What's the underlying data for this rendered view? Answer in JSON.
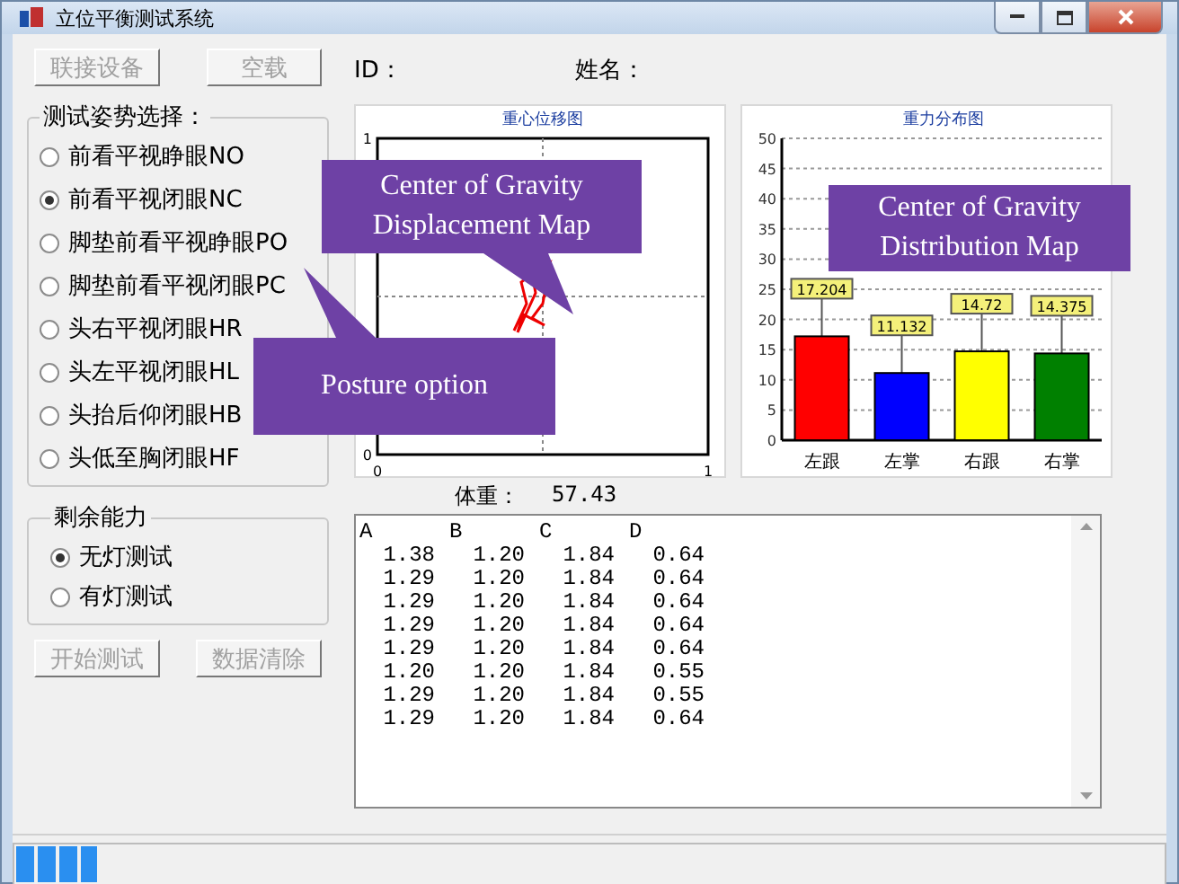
{
  "window": {
    "title": "立位平衡测试系统"
  },
  "top_buttons": [
    {
      "label": "联接设备",
      "disabled": true
    },
    {
      "label": "空载",
      "disabled": true
    }
  ],
  "posture_group": {
    "title": "测试姿势选择：",
    "options": [
      {
        "label": "前看平视睁眼NO",
        "selected": false
      },
      {
        "label": "前看平视闭眼NC",
        "selected": true
      },
      {
        "label": "脚垫前看平视睁眼PO",
        "selected": false
      },
      {
        "label": "脚垫前看平视闭眼PC",
        "selected": false
      },
      {
        "label": "头右平视闭眼HR",
        "selected": false
      },
      {
        "label": "头左平视闭眼HL",
        "selected": false
      },
      {
        "label": "头抬后仰闭眼HB",
        "selected": false
      },
      {
        "label": "头低至胸闭眼HF",
        "selected": false
      }
    ]
  },
  "remaining_group": {
    "title": "剩余能力",
    "options": [
      {
        "label": "无灯测试",
        "selected": true
      },
      {
        "label": "有灯测试",
        "selected": false
      }
    ]
  },
  "bottom_buttons": [
    {
      "label": "开始测试",
      "disabled": true
    },
    {
      "label": "数据清除",
      "disabled": true
    }
  ],
  "patient": {
    "id_label": "ID：",
    "name_label": "姓名："
  },
  "displacement_plot": {
    "title": "重心位移图",
    "x_ticks": [
      "0",
      "1"
    ],
    "y_ticks": [
      "1",
      "0"
    ]
  },
  "distribution_chart": {
    "chart_data": {
      "type": "bar",
      "title": "重力分布图",
      "categories": [
        "左跟",
        "左掌",
        "右跟",
        "右掌"
      ],
      "values": [
        17.204,
        11.132,
        14.72,
        14.375
      ],
      "grid": true,
      "colors": [
        "#ff0000",
        "#0000ff",
        "#ffff00",
        "#008000"
      ],
      "value_labels": [
        "17.204",
        "11.132",
        "14.72",
        "14.375"
      ],
      "ylim": [
        0,
        50
      ],
      "yticks": [
        0,
        5,
        10,
        15,
        20,
        25,
        30,
        35,
        40,
        45,
        50
      ]
    }
  },
  "weight": {
    "label": "体重：",
    "value": "57.43"
  },
  "data_table": {
    "columns": [
      "A",
      "B",
      "C",
      "D"
    ],
    "rows": [
      [
        "1.38",
        "1.20",
        "1.84",
        "0.64"
      ],
      [
        "1.29",
        "1.20",
        "1.84",
        "0.64"
      ],
      [
        "1.29",
        "1.20",
        "1.84",
        "0.64"
      ],
      [
        "1.29",
        "1.20",
        "1.84",
        "0.64"
      ],
      [
        "1.29",
        "1.20",
        "1.84",
        "0.64"
      ],
      [
        "1.20",
        "1.20",
        "1.84",
        "0.55"
      ],
      [
        "1.29",
        "1.20",
        "1.84",
        "0.55"
      ],
      [
        "1.29",
        "1.20",
        "1.84",
        "0.64"
      ]
    ]
  },
  "progress": {
    "level": 0.07
  },
  "annotations": [
    {
      "kind": "displacement",
      "text": "Center of Gravity Displacement Map"
    },
    {
      "kind": "posture",
      "text": "Posture  option"
    },
    {
      "kind": "distribution",
      "text": "Center of Gravity Distribution Map"
    }
  ]
}
